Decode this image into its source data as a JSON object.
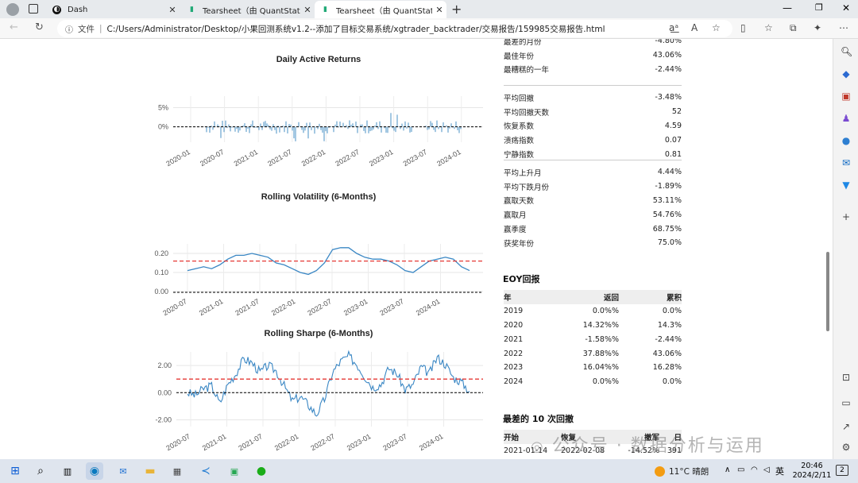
{
  "browser": {
    "tabs": [
      {
        "title": "Dash",
        "icon": "dash-icon"
      },
      {
        "title": "Tearsheet（由 QuantStats 生成）",
        "icon": "chart-icon"
      },
      {
        "title": "Tearsheet（由 QuantStats 生成）",
        "icon": "chart-icon",
        "active": true
      }
    ],
    "address_prefix": "文件",
    "url": "C:/Users/Administrator/Desktop/小果回测系统v1.2--添加了目标交易系统/xgtrader_backtrader/交易报告/159985交易报告.html"
  },
  "charts_text": {
    "daily_title": "Daily Active Returns",
    "vol_title": "Rolling Volatility (6-Months)",
    "sharpe_title": "Rolling Sharpe (6-Months)"
  },
  "chart_data": [
    {
      "type": "bar",
      "title": "Daily Active Returns",
      "yticks": [
        "5%",
        "0%"
      ],
      "ylim": [
        -4,
        8
      ],
      "xticks": [
        "2020-01",
        "2020-07",
        "2021-01",
        "2021-07",
        "2022-01",
        "2022-07",
        "2023-01",
        "2023-07",
        "2024-01"
      ]
    },
    {
      "type": "line",
      "title": "Rolling Volatility (6-Months)",
      "yticks": [
        "0.20",
        "0.10",
        "0.00"
      ],
      "ylim": [
        0,
        0.25
      ],
      "xticks": [
        "2020-07",
        "2021-01",
        "2021-07",
        "2022-01",
        "2022-07",
        "2023-01",
        "2023-07",
        "2024-01"
      ],
      "mean_line": 0.16,
      "zero_line": 0.0,
      "series": [
        {
          "values": [
            0.11,
            0.12,
            0.13,
            0.12,
            0.14,
            0.17,
            0.19,
            0.19,
            0.2,
            0.19,
            0.18,
            0.15,
            0.14,
            0.12,
            0.1,
            0.09,
            0.11,
            0.15,
            0.22,
            0.23,
            0.23,
            0.2,
            0.18,
            0.17,
            0.17,
            0.16,
            0.14,
            0.11,
            0.1,
            0.13,
            0.16,
            0.17,
            0.18,
            0.17,
            0.13,
            0.11
          ]
        }
      ]
    },
    {
      "type": "line",
      "title": "Rolling Sharpe (6-Months)",
      "yticks": [
        "2.00",
        "0.00",
        "-2.00"
      ],
      "ylim": [
        -2.5,
        3
      ],
      "xticks": [
        "2020-07",
        "2021-01",
        "2021-07",
        "2022-01",
        "2022-07",
        "2023-01",
        "2023-07",
        "2024-01"
      ],
      "mean_line": 1.0,
      "zero_line": 0.0,
      "series": [
        {
          "values": [
            0,
            -0.2,
            0.3,
            0.5,
            -0.8,
            0.6,
            1.4,
            2.5,
            2.2,
            1.5,
            2.0,
            1.6,
            0.5,
            -0.6,
            -0.3,
            -0.9,
            -1.6,
            -0.5,
            1.5,
            2.3,
            2.7,
            2.1,
            1.2,
            0.4,
            0.6,
            1.8,
            1.4,
            0.2,
            0.6,
            1.9,
            1.4,
            2.6,
            2.1,
            1.1,
            0.8,
            0.1
          ]
        }
      ]
    }
  ],
  "metrics": {
    "group1": [
      {
        "label": "最差的月份",
        "value": "-4.80%"
      },
      {
        "label": "最佳年份",
        "value": "43.06%"
      },
      {
        "label": "最糟糕的一年",
        "value": "-2.44%"
      }
    ],
    "group2": [
      {
        "label": "平均回撤",
        "value": "-3.48%"
      },
      {
        "label": "平均回撤天数",
        "value": "52"
      },
      {
        "label": "恢复系数",
        "value": "4.59"
      },
      {
        "label": "溃疡指数",
        "value": "0.07"
      },
      {
        "label": "宁静指数",
        "value": "0.81"
      }
    ],
    "group3": [
      {
        "label": "平均上升月",
        "value": "4.44%"
      },
      {
        "label": "平均下跌月份",
        "value": "-1.89%"
      },
      {
        "label": "赢取天数",
        "value": "53.11%"
      },
      {
        "label": "赢取月",
        "value": "54.76%"
      },
      {
        "label": "赢季度",
        "value": "68.75%"
      },
      {
        "label": "获奖年份",
        "value": "75.0%"
      }
    ]
  },
  "eoy": {
    "title": "EOY回报",
    "headers": [
      "年",
      "返回",
      "累积"
    ],
    "rows": [
      [
        "2019",
        "0.0%%",
        "0.0%"
      ],
      [
        "2020",
        "14.32%%",
        "14.3%"
      ],
      [
        "2021",
        "-1.58%%",
        "-2.44%"
      ],
      [
        "2022",
        "37.88%%",
        "43.06%"
      ],
      [
        "2023",
        "16.04%%",
        "16.28%"
      ],
      [
        "2024",
        "0.0%%",
        "0.0%"
      ]
    ]
  },
  "drawdowns": {
    "title": "最差的 10 次回撤",
    "headers": [
      "开始",
      "恢复",
      "撤军",
      "日"
    ],
    "row": [
      "2021-01-14",
      "2022-02-08",
      "-14.52%",
      "391"
    ]
  },
  "watermark": "公众号 · 数据分析与运用",
  "taskbar": {
    "weather": "11°C 晴朗",
    "lang": "英",
    "time": "20:46",
    "date": "2024/2/11",
    "notif": "2"
  }
}
